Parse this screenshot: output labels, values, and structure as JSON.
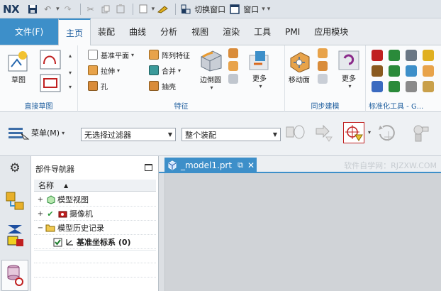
{
  "app": {
    "logo": "NX"
  },
  "quick_access": {
    "switch_window_label": "切换窗口",
    "window_label": "窗口"
  },
  "tabs": [
    {
      "label": "文件(F)"
    },
    {
      "label": "主页"
    },
    {
      "label": "装配"
    },
    {
      "label": "曲线"
    },
    {
      "label": "分析"
    },
    {
      "label": "视图"
    },
    {
      "label": "渲染"
    },
    {
      "label": "工具"
    },
    {
      "label": "PMI"
    },
    {
      "label": "应用模块"
    }
  ],
  "ribbon": {
    "direct_sketch": {
      "label": "直接草图",
      "sketch_label": "草图"
    },
    "feature": {
      "label": "特征",
      "datum_plane": "基准平面",
      "extrude": "拉伸",
      "hole": "孔",
      "pattern_feature": "阵列特征",
      "unite": "合并",
      "shell": "抽壳",
      "edge_blend": "边倒圆",
      "more": "更多"
    },
    "sync_modeling": {
      "label": "同步建模",
      "move_face": "移动面",
      "more": "更多"
    },
    "standard_tools": {
      "label": "标准化工具 - G..."
    }
  },
  "filterbar": {
    "menu_label": "菜单(M)",
    "filter_value": "无选择过滤器",
    "scope_value": "整个装配"
  },
  "navigator": {
    "title": "部件导航器",
    "column_name": "名称",
    "items": [
      {
        "label": "模型视图"
      },
      {
        "label": "摄像机"
      },
      {
        "label": "模型历史记录"
      },
      {
        "label": "基准坐标系 (0)"
      }
    ]
  },
  "document": {
    "tab_label": "_model1.prt",
    "watermark": "软件自学网：RJZXW.COM"
  },
  "colors": {
    "accent": "#3d8fc9",
    "tab_active_text": "#1e5e9e"
  }
}
